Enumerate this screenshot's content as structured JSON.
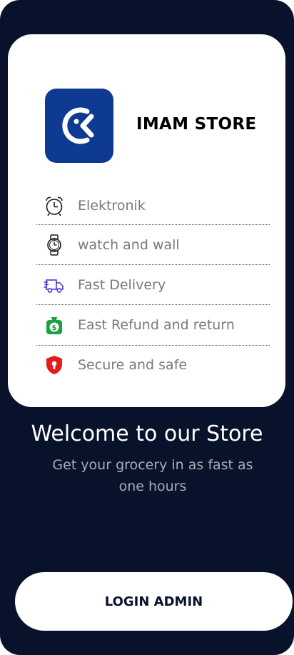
{
  "brand": {
    "name": "IMAM STORE",
    "logo_color": "#0f3a91"
  },
  "features": [
    {
      "label": "Elektronik",
      "icon": "alarm-clock-icon"
    },
    {
      "label": "watch and wall",
      "icon": "wristwatch-icon"
    },
    {
      "label": "Fast Delivery",
      "icon": "delivery-truck-icon"
    },
    {
      "label": "East Refund and return",
      "icon": "money-bag-icon"
    },
    {
      "label": "Secure and safe",
      "icon": "shield-lock-icon"
    }
  ],
  "welcome": {
    "title": "Welcome to our Store",
    "subtitle": "Get your grocery in as fast as one hours"
  },
  "actions": {
    "login_label": "LOGIN ADMIN"
  },
  "colors": {
    "background": "#08122b",
    "card": "#ffffff",
    "truck_icon": "#3b2fd1",
    "bag_icon": "#19a340",
    "shield_icon": "#e61b1b"
  }
}
